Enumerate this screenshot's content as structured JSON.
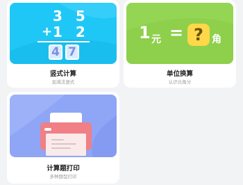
{
  "cards": [
    {
      "title": "竖式计算",
      "subtitle": "加减法竖式",
      "banner": {
        "top_number": "3 5",
        "operator": "+",
        "second_number": "1 2",
        "answer_digits": [
          "4",
          "7"
        ]
      },
      "color": "#1fc7f6"
    },
    {
      "title": "单位换算",
      "subtitle": "认识元角分",
      "banner": {
        "left_value": "1",
        "left_unit": "元",
        "equals": "=",
        "unknown": "?",
        "right_unit": "角"
      },
      "color": "#8ecf4b"
    },
    {
      "title": "计算题打印",
      "subtitle": "多种题型打印",
      "banner": {
        "icon": "printer-icon"
      },
      "color": "#8fa5f5"
    }
  ]
}
